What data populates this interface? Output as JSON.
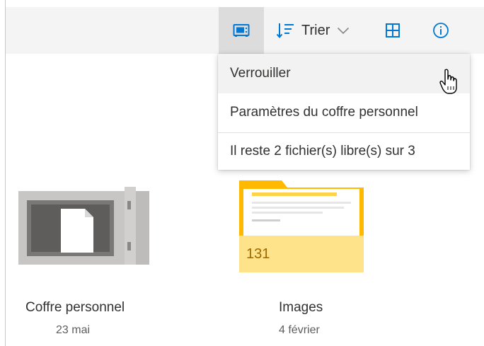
{
  "toolbar": {
    "vault_icon": "vault-icon",
    "sort_label": "Trier",
    "sort_icon": "sort-icon",
    "chevron_icon": "chevron-down-icon",
    "grid_icon": "grid-view-icon",
    "info_icon": "info-icon"
  },
  "menu": {
    "items": [
      {
        "label": "Verrouiller"
      },
      {
        "label": "Paramètres du coffre personnel"
      }
    ],
    "info_text": "Il reste 2 fichier(s) libre(s) sur 3"
  },
  "files": [
    {
      "name": "Coffre personnel",
      "date": "23 mai",
      "icon": "vault-icon"
    },
    {
      "name": "Images",
      "date": "4 février",
      "icon": "folder-icon",
      "count": "131"
    }
  ],
  "colors": {
    "toolbar_bg": "#f4f4f4",
    "accent_blue": "#0078d4",
    "folder_yellow": "#ffb900",
    "folder_front": "#ffe38a",
    "vault_gray": "#c8c6c4"
  }
}
